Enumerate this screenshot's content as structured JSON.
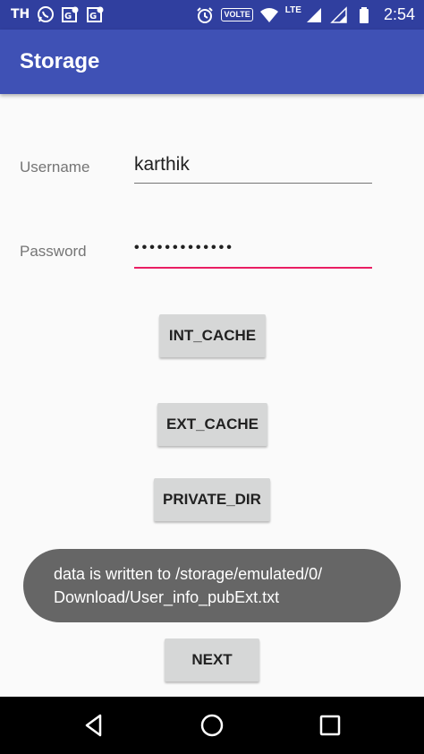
{
  "status_bar": {
    "carrier_text": "TH",
    "network": "VOLTE",
    "lte_label": "LTE",
    "time": "2:54",
    "icons": [
      "whatsapp-icon",
      "maps-icon",
      "maps-icon",
      "alarm-icon",
      "wifi-icon",
      "signal-icon",
      "signal-icon",
      "battery-icon"
    ]
  },
  "app_bar": {
    "title": "Storage"
  },
  "form": {
    "username_label": "Username",
    "username_value": "karthik",
    "password_label": "Password",
    "password_value": "•••••••••••••"
  },
  "buttons": {
    "int_cache": "INT_CACHE",
    "ext_cache": "EXT_CACHE",
    "private_dir": "PRIVATE_DIR",
    "next": "NEXT"
  },
  "toast": {
    "line1": "data is written to /storage/emulated/0/",
    "line2": "Download/User_info_pubExt.txt"
  },
  "colors": {
    "status_bar": "#303f9f",
    "app_bar": "#3f51b5",
    "accent": "#e91e63",
    "button": "#d6d7d7",
    "toast": "#666666"
  }
}
